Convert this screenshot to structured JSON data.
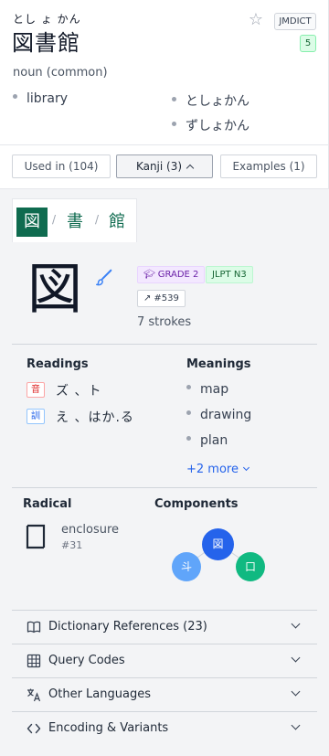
{
  "entry": {
    "reading": "とし ょ かん",
    "headword": "図書館",
    "source_badge": "JMDICT",
    "count_badge": "5",
    "part_of_speech": "noun (common)",
    "senses": [
      "library"
    ],
    "readings": [
      "としょかん",
      "ずしょかん"
    ]
  },
  "tabs": {
    "used_in": "Used in (104)",
    "kanji": "Kanji (3)",
    "examples": "Examples (1)"
  },
  "kanji_tabs": [
    "図",
    "書",
    "館"
  ],
  "kanji_detail": {
    "character": "図",
    "grade": "GRADE 2",
    "jlpt": "JLPT N3",
    "frequency": "#539",
    "strokes": "7 strokes",
    "readings_title": "Readings",
    "on_badge": "音",
    "on_reading": "ズ 、ト",
    "kun_badge": "訓",
    "kun_reading": "え 、はか.る",
    "meanings_title": "Meanings",
    "meanings": [
      "map",
      "drawing",
      "plan"
    ],
    "more_link": "+2 more",
    "radical_title": "Radical",
    "radical_name": "enclosure",
    "radical_number": "#31",
    "components_title": "Components",
    "components": {
      "center": "図",
      "left": "斗",
      "right": "口"
    }
  },
  "accordion": [
    {
      "label": "Dictionary References (23)",
      "icon": "book-icon"
    },
    {
      "label": "Query Codes",
      "icon": "grid-icon"
    },
    {
      "label": "Other Languages",
      "icon": "translate-icon"
    },
    {
      "label": "Encoding & Variants",
      "icon": "code-icon"
    }
  ],
  "colors": {
    "accent_green": "#0f6b4f",
    "node_blue": "#2563eb",
    "node_light_blue": "#60a5fa",
    "node_green": "#10b981",
    "link_blue": "#2563eb"
  }
}
